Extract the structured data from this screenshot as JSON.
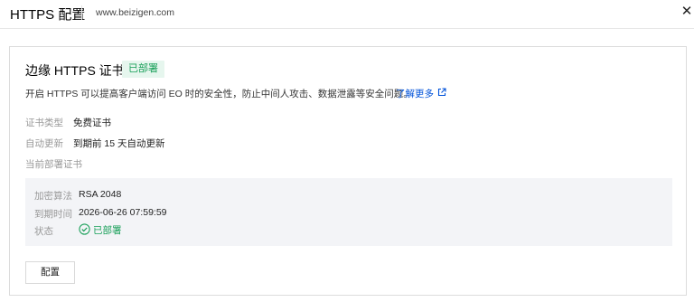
{
  "header": {
    "title": "HTTPS 配置",
    "domain": "www.beizigen.com",
    "close_icon": "✕"
  },
  "card": {
    "title": "边缘 HTTPS 证书",
    "badge": "已部署",
    "description": "开启 HTTPS 可以提高客户端访问 EO 时的安全性，防止中间人攻击、数据泄露等安全问题。",
    "learn_more": "了解更多",
    "fields": [
      {
        "label": "证书类型",
        "value": "免费证书"
      },
      {
        "label": "自动更新",
        "value": "到期前 15 天自动更新"
      },
      {
        "label": "当前部署证书",
        "value": ""
      }
    ],
    "panel": {
      "algo_label": "加密算法",
      "algo_value": "RSA 2048",
      "expire_label": "到期时间",
      "expire_value": "2026-06-26 07:59:59",
      "status_label": "状态",
      "status_value": "已部署"
    },
    "config_button": "配置"
  },
  "colors": {
    "success": "#1aa05a",
    "success_bg": "#e6f6ee",
    "link": "#0052d9",
    "panel_bg": "#f3f4f7"
  },
  "icons": {
    "close": "close-icon",
    "external": "external-link-icon",
    "status": "check-circle-icon"
  }
}
